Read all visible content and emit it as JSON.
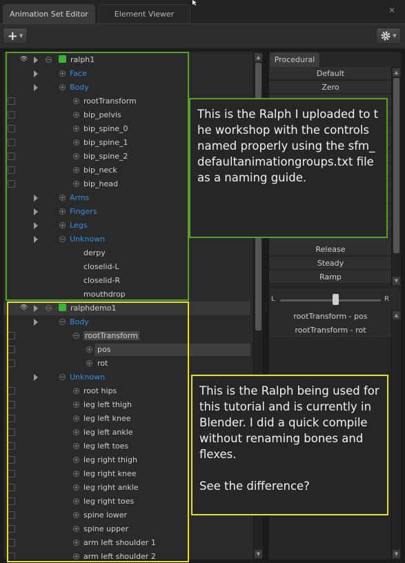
{
  "tabs": {
    "active": "Animation Set Editor",
    "inactive": "Element Viewer",
    "close_glyph": "✕"
  },
  "toolbar": {
    "add_glyph": "+",
    "gear_glyph": "✲"
  },
  "tree": {
    "group1": {
      "root": "ralph1",
      "rows": [
        {
          "label": "Face",
          "kind": "group"
        },
        {
          "label": "Body",
          "kind": "group"
        },
        {
          "label": "rootTransform",
          "kind": "control"
        },
        {
          "label": "bip_pelvis",
          "kind": "control"
        },
        {
          "label": "bip_spine_0",
          "kind": "control"
        },
        {
          "label": "bip_spine_1",
          "kind": "control"
        },
        {
          "label": "bip_spine_2",
          "kind": "control"
        },
        {
          "label": "bip_neck",
          "kind": "control"
        },
        {
          "label": "bip_head",
          "kind": "control"
        },
        {
          "label": "Arms",
          "kind": "group"
        },
        {
          "label": "Fingers",
          "kind": "group"
        },
        {
          "label": "Legs",
          "kind": "group"
        },
        {
          "label": "Unknown",
          "kind": "group-open"
        },
        {
          "label": "derpy",
          "kind": "flex"
        },
        {
          "label": "closelid-L",
          "kind": "flex"
        },
        {
          "label": "closelid-R",
          "kind": "flex"
        },
        {
          "label": "mouthdrop",
          "kind": "flex"
        }
      ]
    },
    "group2": {
      "root": "ralphdemo1",
      "rows": [
        {
          "label": "Body",
          "kind": "group-open"
        },
        {
          "label": "rootTransform",
          "kind": "control-open"
        },
        {
          "label": "pos",
          "kind": "sub"
        },
        {
          "label": "rot",
          "kind": "sub"
        },
        {
          "label": "Unknown",
          "kind": "group-open"
        },
        {
          "label": "root hips",
          "kind": "control"
        },
        {
          "label": "leg left thigh",
          "kind": "control"
        },
        {
          "label": "leg left knee",
          "kind": "control"
        },
        {
          "label": "leg left ankle",
          "kind": "control"
        },
        {
          "label": "leg left toes",
          "kind": "control"
        },
        {
          "label": "leg right thigh",
          "kind": "control"
        },
        {
          "label": "leg right knee",
          "kind": "control"
        },
        {
          "label": "leg right ankle",
          "kind": "control"
        },
        {
          "label": "leg right toes",
          "kind": "control"
        },
        {
          "label": "spine lower",
          "kind": "control"
        },
        {
          "label": "spine upper",
          "kind": "control"
        },
        {
          "label": "arm left shoulder 1",
          "kind": "control"
        },
        {
          "label": "arm left shoulder 2",
          "kind": "control"
        }
      ]
    }
  },
  "procedural": {
    "tab": "Procedural",
    "presets_top": [
      "Default",
      "Zero"
    ],
    "presets_bottom": [
      "Release",
      "Steady",
      "Ramp"
    ],
    "slider": {
      "left": "L",
      "right": "R",
      "value": 0.55
    },
    "targets": [
      "rootTransform - pos",
      "rootTransform - rot"
    ]
  },
  "annotations": {
    "green": "This is the Ralph I uploaded to the workshop with the controls named properly using the sfm_defaultanimationgroups.txt file as a naming guide.",
    "yellow_1": "This is the Ralph being used for this tutorial and is currently in Blender.  I did a quick compile without renaming bones and flexes.",
    "yellow_2": "See the difference?"
  },
  "colors": {
    "green": "#5aa02b",
    "yellow": "#e8e218",
    "group_blue": "#3d8fdc"
  }
}
